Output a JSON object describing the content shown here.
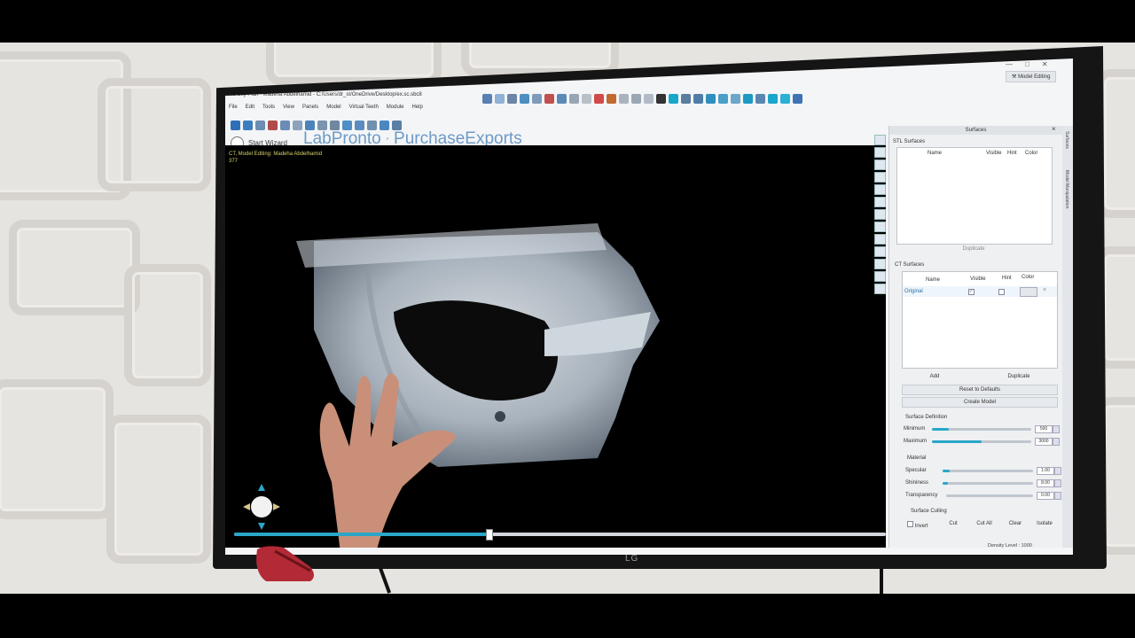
{
  "app": {
    "title": "Blue Sky Plan - Madeha Abdelhamid - C:/Users/dr_st/OneDrive/Desktop/ex.sc.sbc8",
    "mode_button": "Model Editing",
    "menu": [
      "File",
      "Edit",
      "Tools",
      "View",
      "Panels",
      "Model",
      "Virtual Teeth",
      "Module",
      "Help"
    ],
    "start_wizard": "Start Wizard",
    "brand_left": "LabPronto",
    "brand_sep": "·",
    "brand_right": "PurchaseExports"
  },
  "viewport": {
    "info_line1": "CT, Model Editing: Madeha Abdelhamid",
    "info_line2": "377",
    "slider_fraction": 0.39
  },
  "panel": {
    "title": "Surfaces",
    "stl": {
      "label": "STL Surfaces",
      "columns": [
        "Name",
        "Visible",
        "Hint",
        "Color"
      ],
      "duplicate": "Duplicate"
    },
    "ct": {
      "label": "CT Surfaces",
      "columns": [
        "Name",
        "Visible",
        "Hint",
        "Color"
      ],
      "rows": [
        {
          "name": "Original",
          "visible": true,
          "hint": false
        }
      ],
      "add": "Add",
      "duplicate": "Duplicate",
      "reset": "Reset to Defaults",
      "create_model": "Create Model"
    },
    "surface_definition": {
      "label": "Surface Definition",
      "minimum_label": "Minimum",
      "minimum_value": "500",
      "minimum_fraction": 0.17,
      "maximum_label": "Maximum",
      "maximum_value": "3000",
      "maximum_fraction": 0.5
    },
    "material": {
      "label": "Material",
      "specular_label": "Specular",
      "specular_value": "1.00",
      "specular_fraction": 0.08,
      "shininess_label": "Shininess",
      "shininess_value": "8.00",
      "shininess_fraction": 0.06,
      "transparency_label": "Transparency",
      "transparency_value": "0.00",
      "transparency_fraction": 0.0
    },
    "surface_culling": {
      "label": "Surface Culling",
      "invert": "Invert",
      "cut": "Cut",
      "cut_all": "Cut All",
      "clear": "Clear",
      "isolate": "Isolate"
    },
    "status": "Density Level : 1000"
  },
  "side_tabs": [
    "Surfaces",
    "Model Manipulation"
  ],
  "tv": {
    "brand": "LG"
  },
  "colors": {
    "accent": "#2aa6c8",
    "brand": "#6d9ac6",
    "viewport_bg": "#000000"
  }
}
